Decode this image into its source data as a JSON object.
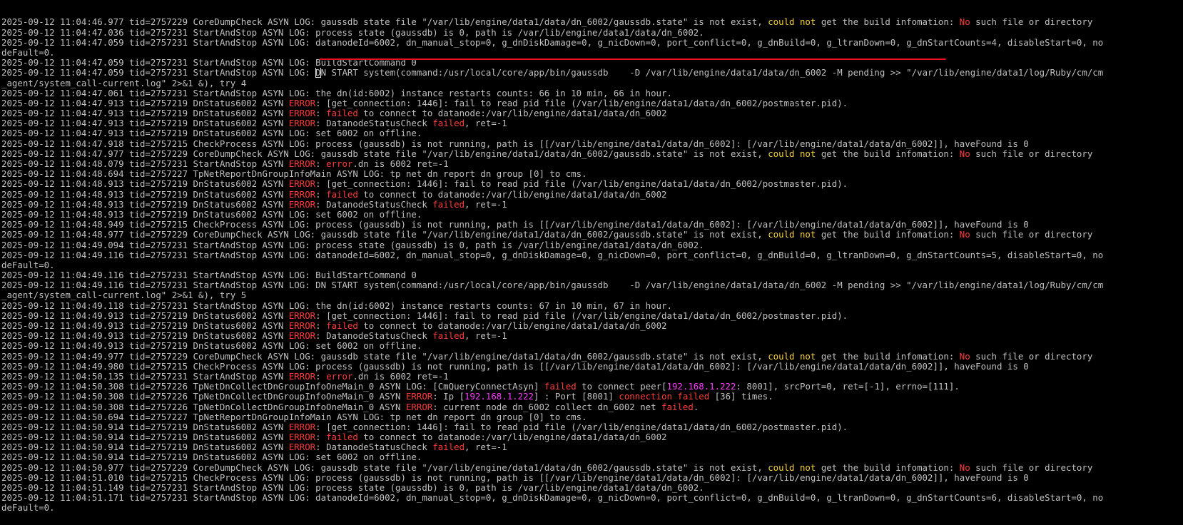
{
  "colors": {
    "background": "#000000",
    "text": "#c0c0c0",
    "error": "#ff3b3b",
    "warning": "#f4d03f",
    "ip": "#ff3bff",
    "annotation": "#e8101e"
  },
  "lines": [
    [
      {
        "t": "2025-09-12 11:04:46.977 tid=2757229 CoreDumpCheck ASYN LOG: gaussdb state file \"/var/lib/engine/data1/data/dn_6002/gaussdb.state\" is not exist, "
      },
      {
        "t": "could not",
        "c": "yellow"
      },
      {
        "t": " get the build infomation: "
      },
      {
        "t": "No",
        "c": "red"
      },
      {
        "t": " such file or directory"
      }
    ],
    [
      {
        "t": "2025-09-12 11:04:47.036 tid=2757231 StartAndStop ASYN LOG: process state (gaussdb) is 0, path is /var/lib/engine/data1/data/dn_6002."
      }
    ],
    [
      {
        "t": "2025-09-12 11:04:47.059 tid=2757231 StartAndStop ASYN LOG: datanodeId=6002, dn_manual_stop=0, g_dnDiskDamage=0, g_nicDown=0, port_conflict=0, g_dnBuild=0, g_ltranDown=0, g_dnStartCounts=4, disableStart=0, no"
      }
    ],
    [
      {
        "t": "deFault=0."
      }
    ],
    [
      {
        "t": "2025-09-12 11:04:47.059 tid=2757231 StartAndStop ASYN LOG: BuildStartCommand 0"
      }
    ],
    [
      {
        "t": "2025-09-12 11:04:47.059 tid=2757231 StartAndStop ASYN LOG: "
      },
      {
        "t": "D",
        "c": "cursor"
      },
      {
        "t": "N START system(command:/usr/local/core/app/bin/gaussdb    -D /var/lib/engine/data1/data/dn_6002 -M pending >> \"/var/lib/engine/data1/log/Ruby/cm/cm"
      }
    ],
    [
      {
        "t": "_agent/system_call-current.log\" 2>&1 &), try 4"
      }
    ],
    [
      {
        "t": "2025-09-12 11:04:47.061 tid=2757231 StartAndStop ASYN LOG: the dn(id:6002) instance restarts counts: 66 in 10 min, 66 in hour."
      }
    ],
    [
      {
        "t": "2025-09-12 11:04:47.913 tid=2757219 DnStatus6002 ASYN "
      },
      {
        "t": "ERROR",
        "c": "red"
      },
      {
        "t": ": [get_connection: 1446]: fail to read pid file (/var/lib/engine/data1/data/dn_6002/postmaster.pid)."
      }
    ],
    [
      {
        "t": "2025-09-12 11:04:47.913 tid=2757219 DnStatus6002 ASYN "
      },
      {
        "t": "ERROR",
        "c": "red"
      },
      {
        "t": ": "
      },
      {
        "t": "failed",
        "c": "red"
      },
      {
        "t": " to connect to datanode:/var/lib/engine/data1/data/dn_6002"
      }
    ],
    [
      {
        "t": "2025-09-12 11:04:47.913 tid=2757219 DnStatus6002 ASYN "
      },
      {
        "t": "ERROR",
        "c": "red"
      },
      {
        "t": ": DatanodeStatusCheck "
      },
      {
        "t": "failed",
        "c": "red"
      },
      {
        "t": ", ret=-1"
      }
    ],
    [
      {
        "t": "2025-09-12 11:04:47.913 tid=2757219 DnStatus6002 ASYN LOG: set 6002 on offline."
      }
    ],
    [
      {
        "t": "2025-09-12 11:04:47.918 tid=2757215 CheckProcess ASYN LOG: process (gaussdb) is not running, path is [[/var/lib/engine/data1/data/dn_6002]: [/var/lib/engine/data1/data/dn_6002]], haveFound is 0"
      }
    ],
    [
      {
        "t": "2025-09-12 11:04:47.977 tid=2757229 CoreDumpCheck ASYN LOG: gaussdb state file \"/var/lib/engine/data1/data/dn_6002/gaussdb.state\" is not exist, "
      },
      {
        "t": "could not",
        "c": "yellow"
      },
      {
        "t": " get the build infomation: "
      },
      {
        "t": "No",
        "c": "red"
      },
      {
        "t": " such file or directory"
      }
    ],
    [
      {
        "t": "2025-09-12 11:04:48.079 tid=2757231 StartAndStop ASYN "
      },
      {
        "t": "ERROR",
        "c": "red"
      },
      {
        "t": ": "
      },
      {
        "t": "error",
        "c": "red"
      },
      {
        "t": ".dn is 6002 ret=-1"
      }
    ],
    [
      {
        "t": "2025-09-12 11:04:48.694 tid=2757227 TpNetReportDnGroupInfoMain ASYN LOG: tp net dn report dn group [0] to cms."
      }
    ],
    [
      {
        "t": "2025-09-12 11:04:48.913 tid=2757219 DnStatus6002 ASYN "
      },
      {
        "t": "ERROR",
        "c": "red"
      },
      {
        "t": ": [get_connection: 1446]: fail to read pid file (/var/lib/engine/data1/data/dn_6002/postmaster.pid)."
      }
    ],
    [
      {
        "t": "2025-09-12 11:04:48.913 tid=2757219 DnStatus6002 ASYN "
      },
      {
        "t": "ERROR",
        "c": "red"
      },
      {
        "t": ": "
      },
      {
        "t": "failed",
        "c": "red"
      },
      {
        "t": " to connect to datanode:/var/lib/engine/data1/data/dn_6002"
      }
    ],
    [
      {
        "t": "2025-09-12 11:04:48.913 tid=2757219 DnStatus6002 ASYN "
      },
      {
        "t": "ERROR",
        "c": "red"
      },
      {
        "t": ": DatanodeStatusCheck "
      },
      {
        "t": "failed",
        "c": "red"
      },
      {
        "t": ", ret=-1"
      }
    ],
    [
      {
        "t": "2025-09-12 11:04:48.913 tid=2757219 DnStatus6002 ASYN LOG: set 6002 on offline."
      }
    ],
    [
      {
        "t": "2025-09-12 11:04:48.949 tid=2757215 CheckProcess ASYN LOG: process (gaussdb) is not running, path is [[/var/lib/engine/data1/data/dn_6002]: [/var/lib/engine/data1/data/dn_6002]], haveFound is 0"
      }
    ],
    [
      {
        "t": "2025-09-12 11:04:48.977 tid=2757229 CoreDumpCheck ASYN LOG: gaussdb state file \"/var/lib/engine/data1/data/dn_6002/gaussdb.state\" is not exist, "
      },
      {
        "t": "could not",
        "c": "yellow"
      },
      {
        "t": " get the build infomation: "
      },
      {
        "t": "No",
        "c": "red"
      },
      {
        "t": " such file or directory"
      }
    ],
    [
      {
        "t": "2025-09-12 11:04:49.094 tid=2757231 StartAndStop ASYN LOG: process state (gaussdb) is 0, path is /var/lib/engine/data1/data/dn_6002."
      }
    ],
    [
      {
        "t": "2025-09-12 11:04:49.116 tid=2757231 StartAndStop ASYN LOG: datanodeId=6002, dn_manual_stop=0, g_dnDiskDamage=0, g_nicDown=0, port_conflict=0, g_dnBuild=0, g_ltranDown=0, g_dnStartCounts=5, disableStart=0, no"
      }
    ],
    [
      {
        "t": "deFault=0."
      }
    ],
    [
      {
        "t": "2025-09-12 11:04:49.116 tid=2757231 StartAndStop ASYN LOG: BuildStartCommand 0"
      }
    ],
    [
      {
        "t": "2025-09-12 11:04:49.116 tid=2757231 StartAndStop ASYN LOG: DN START system(command:/usr/local/core/app/bin/gaussdb    -D /var/lib/engine/data1/data/dn_6002 -M pending >> \"/var/lib/engine/data1/log/Ruby/cm/cm"
      }
    ],
    [
      {
        "t": "_agent/system_call-current.log\" 2>&1 &), try 5"
      }
    ],
    [
      {
        "t": "2025-09-12 11:04:49.118 tid=2757231 StartAndStop ASYN LOG: the dn(id:6002) instance restarts counts: 67 in 10 min, 67 in hour."
      }
    ],
    [
      {
        "t": "2025-09-12 11:04:49.913 tid=2757219 DnStatus6002 ASYN "
      },
      {
        "t": "ERROR",
        "c": "red"
      },
      {
        "t": ": [get_connection: 1446]: fail to read pid file (/var/lib/engine/data1/data/dn_6002/postmaster.pid)."
      }
    ],
    [
      {
        "t": "2025-09-12 11:04:49.913 tid=2757219 DnStatus6002 ASYN "
      },
      {
        "t": "ERROR",
        "c": "red"
      },
      {
        "t": ": "
      },
      {
        "t": "failed",
        "c": "red"
      },
      {
        "t": " to connect to datanode:/var/lib/engine/data1/data/dn_6002"
      }
    ],
    [
      {
        "t": "2025-09-12 11:04:49.913 tid=2757219 DnStatus6002 ASYN "
      },
      {
        "t": "ERROR",
        "c": "red"
      },
      {
        "t": ": DatanodeStatusCheck "
      },
      {
        "t": "failed",
        "c": "red"
      },
      {
        "t": ", ret=-1"
      }
    ],
    [
      {
        "t": "2025-09-12 11:04:49.913 tid=2757219 DnStatus6002 ASYN LOG: set 6002 on offline."
      }
    ],
    [
      {
        "t": "2025-09-12 11:04:49.977 tid=2757229 CoreDumpCheck ASYN LOG: gaussdb state file \"/var/lib/engine/data1/data/dn_6002/gaussdb.state\" is not exist, "
      },
      {
        "t": "could not",
        "c": "yellow"
      },
      {
        "t": " get the build infomation: "
      },
      {
        "t": "No",
        "c": "red"
      },
      {
        "t": " such file or directory"
      }
    ],
    [
      {
        "t": "2025-09-12 11:04:49.980 tid=2757215 CheckProcess ASYN LOG: process (gaussdb) is not running, path is [[/var/lib/engine/data1/data/dn_6002]: [/var/lib/engine/data1/data/dn_6002]], haveFound is 0"
      }
    ],
    [
      {
        "t": "2025-09-12 11:04:50.135 tid=2757231 StartAndStop ASYN "
      },
      {
        "t": "ERROR",
        "c": "red"
      },
      {
        "t": ": "
      },
      {
        "t": "error",
        "c": "red"
      },
      {
        "t": ".dn is 6002 ret=-1"
      }
    ],
    [
      {
        "t": "2025-09-12 11:04:50.308 tid=2757226 TpNetDnCollectDnGroupInfoOneMain_0 ASYN LOG: [CmQueryConnectAsyn] "
      },
      {
        "t": "failed",
        "c": "red"
      },
      {
        "t": " to connect peer["
      },
      {
        "t": "192.168.1.222",
        "c": "magenta"
      },
      {
        "t": ": 8001], srcPort=0, ret=[-1], errno=[111]."
      }
    ],
    [
      {
        "t": "2025-09-12 11:04:50.308 tid=2757226 TpNetDnCollectDnGroupInfoOneMain_0 ASYN "
      },
      {
        "t": "ERROR",
        "c": "red"
      },
      {
        "t": ": Ip ["
      },
      {
        "t": "192.168.1.222",
        "c": "magenta"
      },
      {
        "t": "] : Port [8001] "
      },
      {
        "t": "connection failed",
        "c": "red"
      },
      {
        "t": " [36] times."
      }
    ],
    [
      {
        "t": "2025-09-12 11:04:50.308 tid=2757226 TpNetDnCollectDnGroupInfoOneMain_0 ASYN "
      },
      {
        "t": "ERROR",
        "c": "red"
      },
      {
        "t": ": current node dn_6002 collect dn_6002 net "
      },
      {
        "t": "failed",
        "c": "red"
      },
      {
        "t": "."
      }
    ],
    [
      {
        "t": "2025-09-12 11:04:50.694 tid=2757227 TpNetReportDnGroupInfoMain ASYN LOG: tp net dn report dn group [0] to cms."
      }
    ],
    [
      {
        "t": "2025-09-12 11:04:50.914 tid=2757219 DnStatus6002 ASYN "
      },
      {
        "t": "ERROR",
        "c": "red"
      },
      {
        "t": ": [get_connection: 1446]: fail to read pid file (/var/lib/engine/data1/data/dn_6002/postmaster.pid)."
      }
    ],
    [
      {
        "t": "2025-09-12 11:04:50.914 tid=2757219 DnStatus6002 ASYN "
      },
      {
        "t": "ERROR",
        "c": "red"
      },
      {
        "t": ": "
      },
      {
        "t": "failed",
        "c": "red"
      },
      {
        "t": " to connect to datanode:/var/lib/engine/data1/data/dn_6002"
      }
    ],
    [
      {
        "t": "2025-09-12 11:04:50.914 tid=2757219 DnStatus6002 ASYN "
      },
      {
        "t": "ERROR",
        "c": "red"
      },
      {
        "t": ": DatanodeStatusCheck "
      },
      {
        "t": "failed",
        "c": "red"
      },
      {
        "t": ", ret=-1"
      }
    ],
    [
      {
        "t": "2025-09-12 11:04:50.914 tid=2757219 DnStatus6002 ASYN LOG: set 6002 on offline."
      }
    ],
    [
      {
        "t": "2025-09-12 11:04:50.977 tid=2757229 CoreDumpCheck ASYN LOG: gaussdb state file \"/var/lib/engine/data1/data/dn_6002/gaussdb.state\" is not exist, "
      },
      {
        "t": "could not",
        "c": "yellow"
      },
      {
        "t": " get the build infomation: "
      },
      {
        "t": "No",
        "c": "red"
      },
      {
        "t": " such file or directory"
      }
    ],
    [
      {
        "t": "2025-09-12 11:04:51.010 tid=2757215 CheckProcess ASYN LOG: process (gaussdb) is not running, path is [[/var/lib/engine/data1/data/dn_6002]: [/var/lib/engine/data1/data/dn_6002]], haveFound is 0"
      }
    ],
    [
      {
        "t": "2025-09-12 11:04:51.149 tid=2757231 StartAndStop ASYN LOG: process state (gaussdb) is 0, path is /var/lib/engine/data1/data/dn_6002."
      }
    ],
    [
      {
        "t": "2025-09-12 11:04:51.171 tid=2757231 StartAndStop ASYN LOG: datanodeId=6002, dn_manual_stop=0, g_dnDiskDamage=0, g_nicDown=0, port_conflict=0, g_dnBuild=0, g_ltranDown=0, g_dnStartCounts=6, disableStart=0, no"
      }
    ],
    [
      {
        "t": "deFault=0."
      }
    ]
  ]
}
